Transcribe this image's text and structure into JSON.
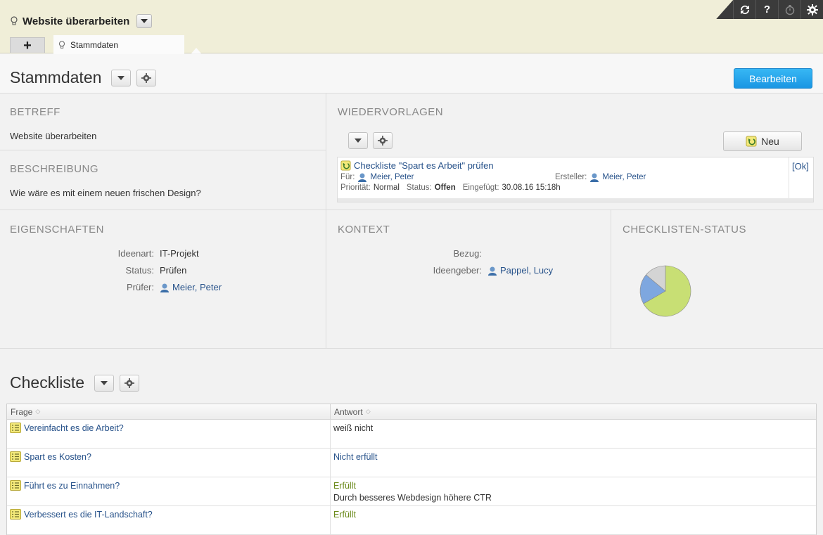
{
  "header": {
    "title": "Website überarbeiten",
    "add_tab_label": "+",
    "active_tab": "Stammdaten",
    "tools": [
      "sync-icon",
      "help-icon",
      "timer-icon",
      "gear-icon"
    ],
    "help_label": "?"
  },
  "stammdaten": {
    "title": "Stammdaten",
    "edit_label": "Bearbeiten"
  },
  "betreff": {
    "heading": "BETREFF",
    "value": "Website überarbeiten"
  },
  "beschreibung": {
    "heading": "BESCHREIBUNG",
    "value": "Wie wäre es mit einem neuen frischen Design?"
  },
  "wiedervorlagen": {
    "heading": "WIEDERVORLAGEN",
    "new_label": "Neu",
    "item": {
      "title": "Checkliste \"Spart es Arbeit\" prüfen",
      "fuer_label": "Für:",
      "fuer_value": "Meier, Peter",
      "ersteller_label": "Ersteller:",
      "ersteller_value": "Meier, Peter",
      "prioritaet_label": "Priorität:",
      "prioritaet_value": "Normal",
      "status_label": "Status:",
      "status_value": "Offen",
      "eingefuegt_label": "Eingefügt:",
      "eingefuegt_value": "30.08.16 15:18h",
      "ok_label": "[Ok]"
    }
  },
  "eigenschaften": {
    "heading": "EIGENSCHAFTEN",
    "ideenart_label": "Ideenart:",
    "ideenart_value": "IT-Projekt",
    "status_label": "Status:",
    "status_value": "Prüfen",
    "pruefer_label": "Prüfer:",
    "pruefer_value": "Meier, Peter"
  },
  "kontext": {
    "heading": "KONTEXT",
    "bezug_label": "Bezug:",
    "ideengeber_label": "Ideengeber:",
    "ideengeber_value": "Pappel, Lucy"
  },
  "checklisten_status": {
    "heading": "CHECKLISTEN-STATUS",
    "slices": [
      {
        "name": "Erfüllt",
        "value": 0.667,
        "color": "#c8df74"
      },
      {
        "name": "Nicht erfüllt",
        "value": 0.194,
        "color": "#7ea7df"
      },
      {
        "name": "weiß nicht",
        "value": 0.139,
        "color": "#d4d4d4"
      }
    ]
  },
  "checkliste": {
    "title": "Checkliste",
    "col_frage": "Frage",
    "col_antwort": "Antwort",
    "rows": [
      {
        "frage": "Vereinfacht es die Arbeit?",
        "antwort": "weiß nicht",
        "antwort_color": "#333333",
        "note": ""
      },
      {
        "frage": "Spart es Kosten?",
        "antwort": "Nicht erfüllt",
        "antwort_color": "#27528a",
        "note": ""
      },
      {
        "frage": "Führt es zu Einnahmen?",
        "antwort": "Erfüllt",
        "antwort_color": "#6b8a1b",
        "note": "Durch besseres Webdesign höhere CTR"
      },
      {
        "frage": "Verbessert es die IT-Landschaft?",
        "antwort": "Erfüllt",
        "antwort_color": "#6b8a1b",
        "note": ""
      }
    ]
  },
  "colors": {
    "accent": "#1a96e3",
    "link": "#27528a",
    "header_bg": "#f0eed8"
  }
}
